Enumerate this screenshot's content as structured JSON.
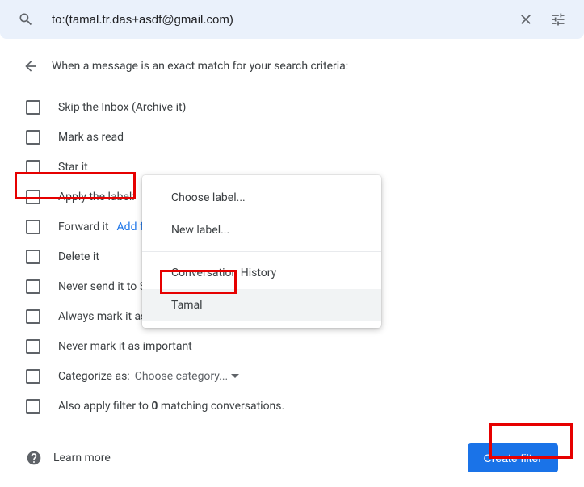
{
  "search": {
    "value": "to:(tamal.tr.das+asdf@gmail.com)"
  },
  "header": {
    "text": "When a message is an exact match for your search criteria:"
  },
  "options": {
    "skip_inbox": "Skip the Inbox (Archive it)",
    "mark_read": "Mark as read",
    "star": "Star it",
    "apply_label": "Apply the label:",
    "forward": "Forward it",
    "forward_link": "Add forwarding address",
    "delete": "Delete it",
    "never_spam": "Never send it to Spam",
    "always_important": "Always mark it as important",
    "never_important": "Never mark it as important",
    "categorize": "Categorize as:",
    "categorize_choice": "Choose category...",
    "also_apply_prefix": "Also apply filter to ",
    "also_apply_count": "0",
    "also_apply_suffix": " matching conversations."
  },
  "menu": {
    "choose": "Choose label...",
    "new": "New label...",
    "history": "Conversation History",
    "tamal": "Tamal"
  },
  "footer": {
    "learn_more": "Learn more",
    "create": "Create filter"
  }
}
